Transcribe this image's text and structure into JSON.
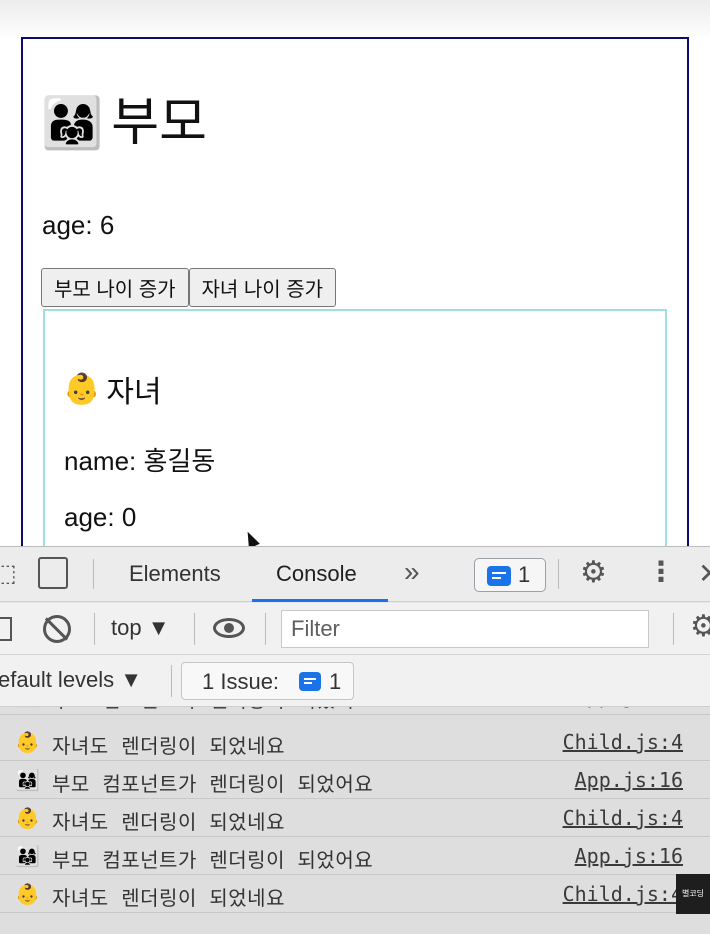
{
  "page": {
    "parent_emoji": "👨‍👩‍👧",
    "parent_title": "부모",
    "parent_age": "age: 6",
    "buttons": [
      "부모 나이 증가",
      "자녀 나이 증가"
    ],
    "child_emoji": "👶",
    "child_title": "자녀",
    "child_name": "name: 홍길동",
    "child_age": "age: 0"
  },
  "devtools": {
    "tabs": [
      "Elements",
      "Console"
    ],
    "active_tab": "Console",
    "more_tabs": "»",
    "message_count": "1",
    "context": "top ▼",
    "filter_placeholder": "Filter",
    "levels": "efault levels ▼",
    "issue_label": "1 Issue:",
    "issue_count": "1",
    "accent_color": "#1a73e8"
  },
  "console_logs": [
    {
      "emoji": "👶",
      "text": "자녀도 렌더링이 되었네요",
      "source": "Child.js:4"
    },
    {
      "emoji": "👨‍👩‍👧",
      "text": "부모 컴포넌트가 렌더링이 되었어요",
      "source": "App.js:16"
    },
    {
      "emoji": "👶",
      "text": "자녀도 렌더링이 되었네요",
      "source": "Child.js:4"
    },
    {
      "emoji": "👨‍👩‍👧",
      "text": "부모 컴포넌트가 렌더링이 되었어요",
      "source": "App.js:16"
    },
    {
      "emoji": "👶",
      "text": "자녀도 렌더링이 되었네요",
      "source": "Child.js:4"
    }
  ],
  "watermark": "별코딩"
}
